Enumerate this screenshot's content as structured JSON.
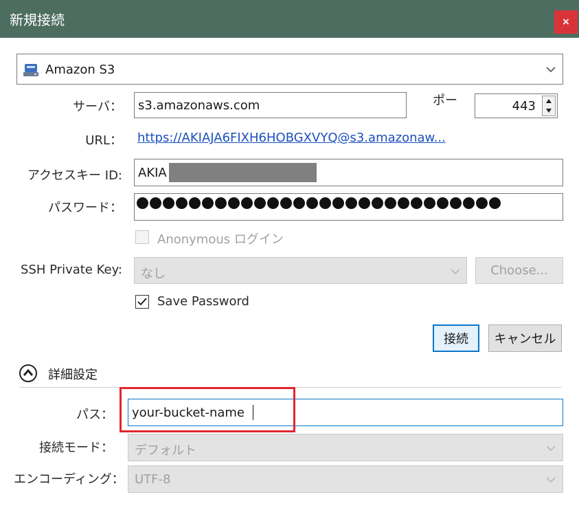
{
  "window": {
    "title": "新規接続",
    "close_label": "×"
  },
  "protocol": {
    "selected": "Amazon S3"
  },
  "server": {
    "label": "サーバ：",
    "value": "s3.amazonaws.com"
  },
  "port": {
    "label": "ポー",
    "value": "443"
  },
  "url": {
    "label": "URL：",
    "value": "https://AKIAJA6FIXH6HOBGXVYQ@s3.amazonaw..."
  },
  "access_key": {
    "label": "アクセスキー ID:",
    "value": "AKIA"
  },
  "password": {
    "label": "パスワード：",
    "dot_count": 28
  },
  "anonymous": {
    "label": "Anonymous ログイン",
    "checked": false,
    "enabled": false
  },
  "ssh_key": {
    "label": "SSH Private Key:",
    "value": "なし",
    "choose_label": "Choose..."
  },
  "save_password": {
    "label": "Save Password",
    "checked": true
  },
  "buttons": {
    "connect": "接続",
    "cancel": "キャンセル"
  },
  "advanced": {
    "title": "詳細設定"
  },
  "path": {
    "label": "パス：",
    "value": "your-bucket-name"
  },
  "connect_mode": {
    "label": "接続モード：",
    "value": "デフォルト"
  },
  "encoding": {
    "label": "エンコーディング：",
    "value": "UTF-8"
  },
  "colors": {
    "titlebar": "#4e6d61",
    "close": "#d9333a",
    "link": "#1b4fbf",
    "highlight": "#e0262e",
    "focus": "#0a76c7"
  }
}
